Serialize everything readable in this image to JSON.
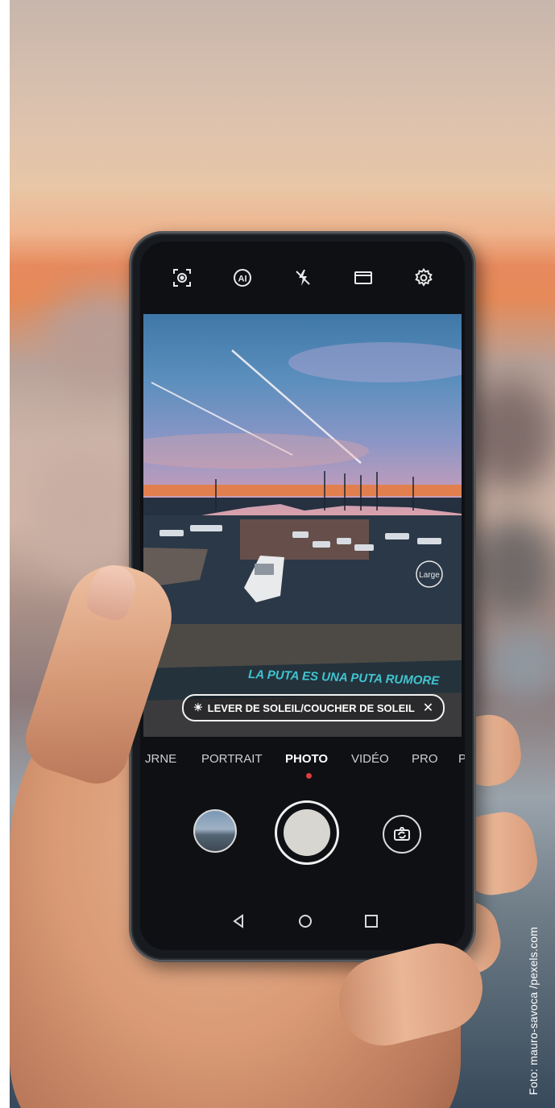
{
  "camera": {
    "top_icons": [
      "focus-icon",
      "ai-icon",
      "flash-off-icon",
      "aspect-ratio-icon",
      "gear-icon"
    ],
    "scene_badge": "LEVER DE SOLEIL/COUCHER DE SOLEIL",
    "zoom_badge": "Large",
    "modes": [
      "JRNE",
      "PORTRAIT",
      "PHOTO",
      "VIDÉO",
      "PRO",
      "P"
    ],
    "active_mode": "PHOTO",
    "colors": {
      "active_dot": "#e23b3b",
      "sky_top": "#3f78a8",
      "horizon": "#ee7f3f"
    }
  },
  "graffiti_text": "LA PUTA ES UNA PUTA RUMORE",
  "credit": "Foto: mauro-savoca /pexels.com"
}
